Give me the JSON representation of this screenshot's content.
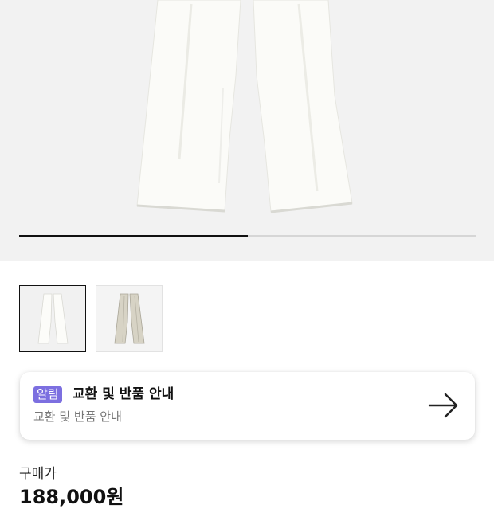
{
  "gallery": {
    "main_image": "white-wide-pants-image",
    "progress_fraction": 0.5,
    "thumbnails": [
      {
        "name": "white-pants-thumbnail",
        "active": true
      },
      {
        "name": "beige-pants-thumbnail",
        "active": false
      }
    ]
  },
  "notice": {
    "badge": "알림",
    "title": "교환 및 반품 안내",
    "subtitle": "교환 및 반품 안내",
    "arrow_icon": "arrow-right-icon",
    "badge_color": "#7c6fe0"
  },
  "price": {
    "label": "구매가",
    "value": "188,000원"
  }
}
